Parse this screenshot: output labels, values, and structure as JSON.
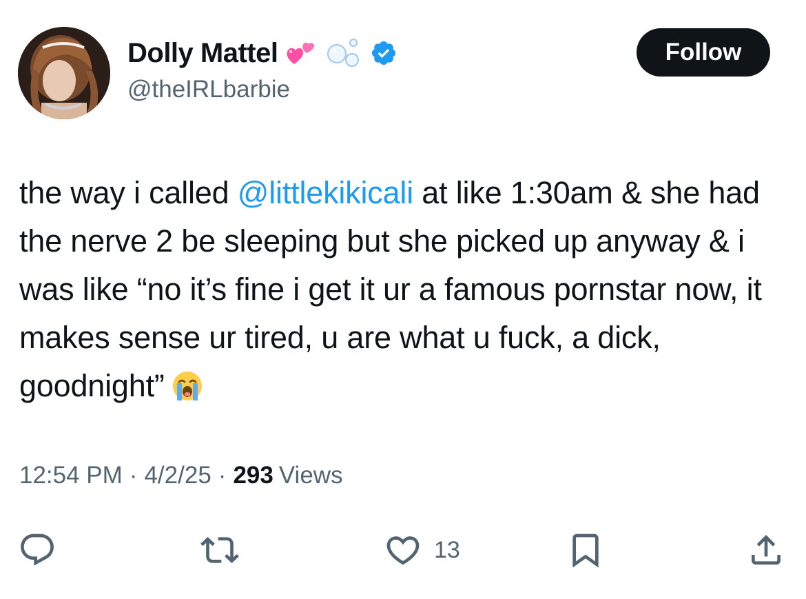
{
  "author": {
    "display_name": "Dolly Mattel",
    "handle": "@theIRLbarbie",
    "name_emojis": [
      "two-hearts-icon",
      "bubbles-icon"
    ],
    "verified": true,
    "verified_color": "#1d9bf0"
  },
  "follow": {
    "label": "Follow",
    "background": "#0f1419"
  },
  "tweet": {
    "text_before_mention": "the way i called ",
    "mention": "@littlekikicali",
    "text_after_mention": " at like 1:30am & she had the nerve 2 be sleeping but she picked up anyway & i was like “no it’s fine i get it ur a famous pornstar now, it makes sense ur tired, u are what u fuck, a dick, goodnight”",
    "trailing_emoji": "loudly-crying-face-icon",
    "mention_color": "#1d9bf0"
  },
  "meta": {
    "time": "12:54 PM",
    "separator": "·",
    "date": "4/2/25",
    "views_count": "293",
    "views_label": "Views"
  },
  "actions": {
    "reply_icon": "reply-icon",
    "retweet_icon": "retweet-icon",
    "like_icon": "heart-icon",
    "like_count": "13",
    "bookmark_icon": "bookmark-icon",
    "share_icon": "share-icon"
  },
  "colors": {
    "text_primary": "#0f1419",
    "text_secondary": "#536471",
    "accent": "#1d9bf0"
  }
}
